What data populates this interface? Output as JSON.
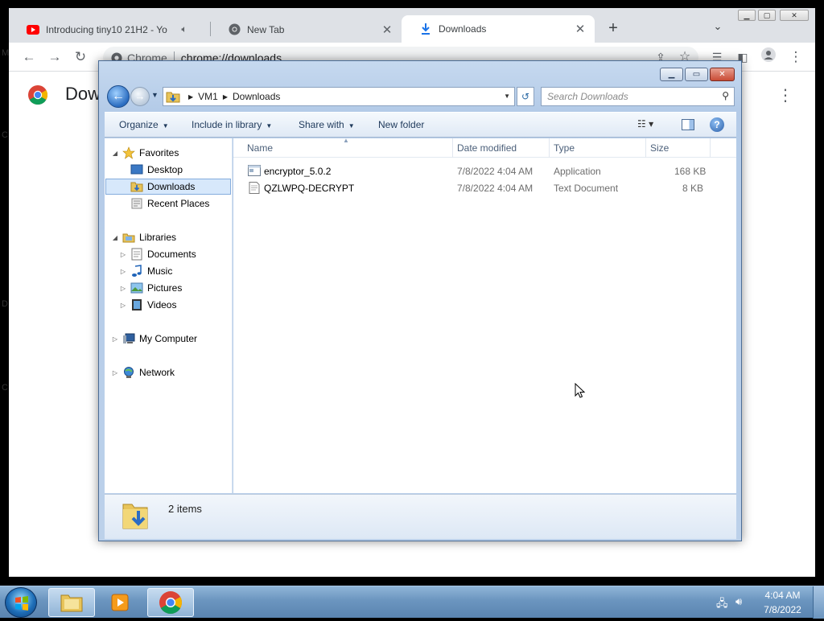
{
  "browser": {
    "tabs": [
      {
        "title": "Introducing tiny10 21H2 - Yo",
        "icon": "youtube-icon"
      },
      {
        "title": "New Tab",
        "icon": "chrome-icon"
      },
      {
        "title": "Downloads",
        "icon": "download-icon",
        "active": true
      }
    ],
    "omnibox": {
      "chip": "Chrome",
      "url": "chrome://downloads"
    },
    "page_title": "Dow"
  },
  "edge_letters": [
    "M",
    "C",
    "D",
    "C"
  ],
  "explorer": {
    "breadcrumb": [
      "VM1",
      "Downloads"
    ],
    "search_placeholder": "Search Downloads",
    "commands": {
      "organize": "Organize",
      "include_library": "Include in library",
      "share_with": "Share with",
      "new_folder": "New folder"
    },
    "nav": {
      "favorites": "Favorites",
      "desktop": "Desktop",
      "downloads": "Downloads",
      "recent": "Recent Places",
      "libraries": "Libraries",
      "documents": "Documents",
      "music": "Music",
      "pictures": "Pictures",
      "videos": "Videos",
      "computer": "My Computer",
      "network": "Network"
    },
    "columns": {
      "name": "Name",
      "date": "Date modified",
      "type": "Type",
      "size": "Size"
    },
    "files": [
      {
        "name": "encryptor_5.0.2",
        "date": "7/8/2022 4:04 AM",
        "type": "Application",
        "size": "168 KB"
      },
      {
        "name": "QZLWPQ-DECRYPT",
        "date": "7/8/2022 4:04 AM",
        "type": "Text Document",
        "size": "8 KB"
      }
    ],
    "status": "2 items"
  },
  "taskbar": {
    "time": "4:04 AM",
    "date": "7/8/2022"
  }
}
